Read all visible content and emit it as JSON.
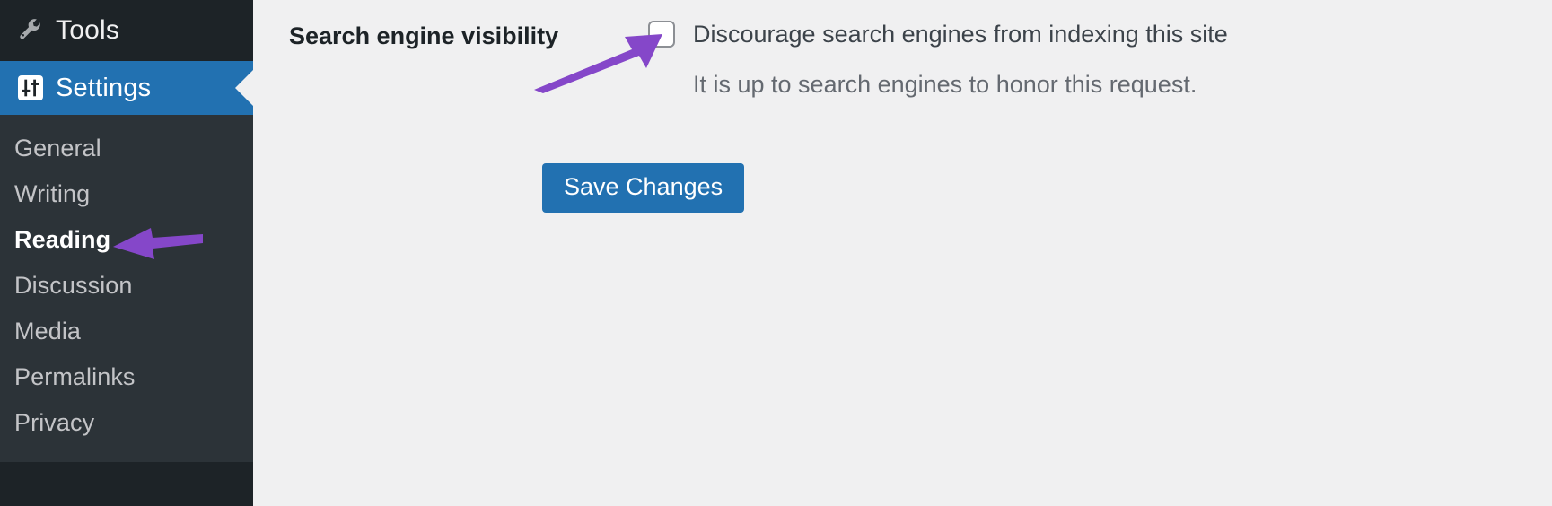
{
  "sidebar": {
    "top_items": [
      {
        "label": "Tools",
        "icon": "wrench-icon",
        "active": false
      },
      {
        "label": "Settings",
        "icon": "sliders-icon",
        "active": true
      }
    ],
    "submenu_items": [
      {
        "label": "General",
        "current": false
      },
      {
        "label": "Writing",
        "current": false
      },
      {
        "label": "Reading",
        "current": true
      },
      {
        "label": "Discussion",
        "current": false
      },
      {
        "label": "Media",
        "current": false
      },
      {
        "label": "Permalinks",
        "current": false
      },
      {
        "label": "Privacy",
        "current": false
      }
    ]
  },
  "main": {
    "setting_row": {
      "title": "Search engine visibility",
      "checkbox_label": "Discourage search engines from indexing this site",
      "checkbox_checked": false,
      "help_text": "It is up to search engines to honor this request."
    },
    "submit": {
      "label": "Save Changes"
    }
  },
  "annotations": [
    {
      "name": "arrow-to-checkbox",
      "direction": "up-right",
      "color": "#8547c9"
    },
    {
      "name": "arrow-to-reading",
      "direction": "left",
      "color": "#8547c9"
    }
  ],
  "colors": {
    "sidebar_bg": "#1d2327",
    "submenu_bg": "#2c3338",
    "active_blue": "#2271b1",
    "content_bg": "#f0f0f1",
    "annotation_purple": "#8547c9"
  }
}
